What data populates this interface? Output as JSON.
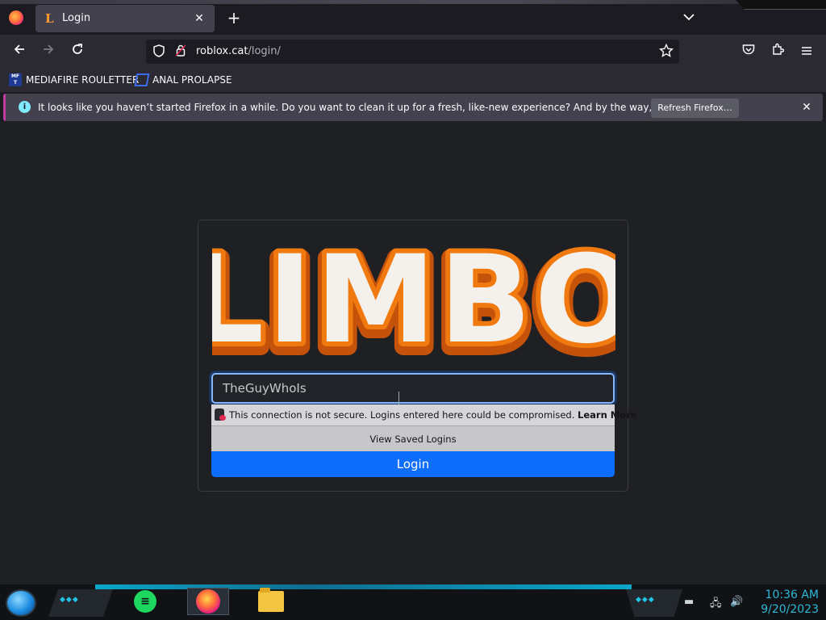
{
  "browser": {
    "tab": {
      "title": "Login",
      "favicon": "L"
    },
    "new_tab_icon": "+",
    "list_tabs_icon": "⌄",
    "url": {
      "host": "roblox.cat",
      "path": "/login/"
    },
    "bookmarks": [
      {
        "label": "MEDIAFIRE ROULETTER",
        "icon_text": "MF T"
      },
      {
        "label": "ANAL PROLAPSE"
      }
    ],
    "notification": {
      "message": "It looks like you haven’t started Firefox in a while. Do you want to clean it up for a fresh, like-new experience? And by the way, welcome back!",
      "button": "Refresh Firefox…"
    }
  },
  "page": {
    "logo_text": "LIMBO",
    "username_value": "TheGuyWhoIs",
    "insecure_warning": {
      "text": "This connection is not secure. Logins entered here could be compromised.",
      "link": "Learn More"
    },
    "view_saved_logins": "View Saved Logins",
    "login_button": "Login"
  },
  "taskbar": {
    "time": "10:36 AM",
    "date": "9/20/2023"
  },
  "colors": {
    "accent": "#0d6efd",
    "logo_fill": "#f4f0ec",
    "logo_outline": "#f07a10",
    "taskbar_accent": "#2fb8d8"
  }
}
